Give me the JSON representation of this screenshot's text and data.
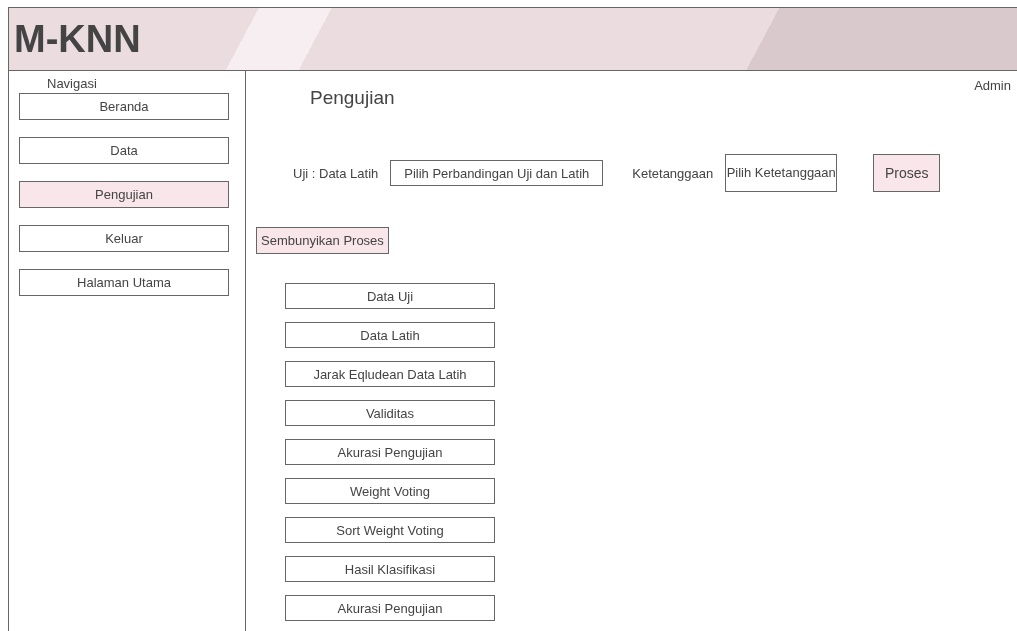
{
  "header": {
    "title": "M-KNN"
  },
  "sidebar": {
    "heading": "Navigasi",
    "items": [
      {
        "label": "Beranda",
        "selected": false
      },
      {
        "label": "Data",
        "selected": false
      },
      {
        "label": "Pengujian",
        "selected": true
      },
      {
        "label": "Keluar",
        "selected": false
      },
      {
        "label": "Halaman Utama",
        "selected": false
      }
    ]
  },
  "main": {
    "title": "Pengujian",
    "user": "Admin",
    "test_label": "Uji : Data Latih",
    "comparison_select": "Pilih Perbandingan Uji dan Latih",
    "neighbor_label": "Ketetanggaan",
    "neighbor_select": "Pilih Ketetanggaan",
    "process_button": "Proses",
    "hide_button": "Sembunyikan Proses",
    "result_buttons": [
      "Data Uji",
      "Data Latih",
      "Jarak Eqludean Data Latih",
      "Validitas",
      "Akurasi Pengujian",
      "Weight Voting",
      "Sort Weight Voting",
      "Hasil Klasifikasi",
      "Akurasi Pengujian"
    ]
  }
}
